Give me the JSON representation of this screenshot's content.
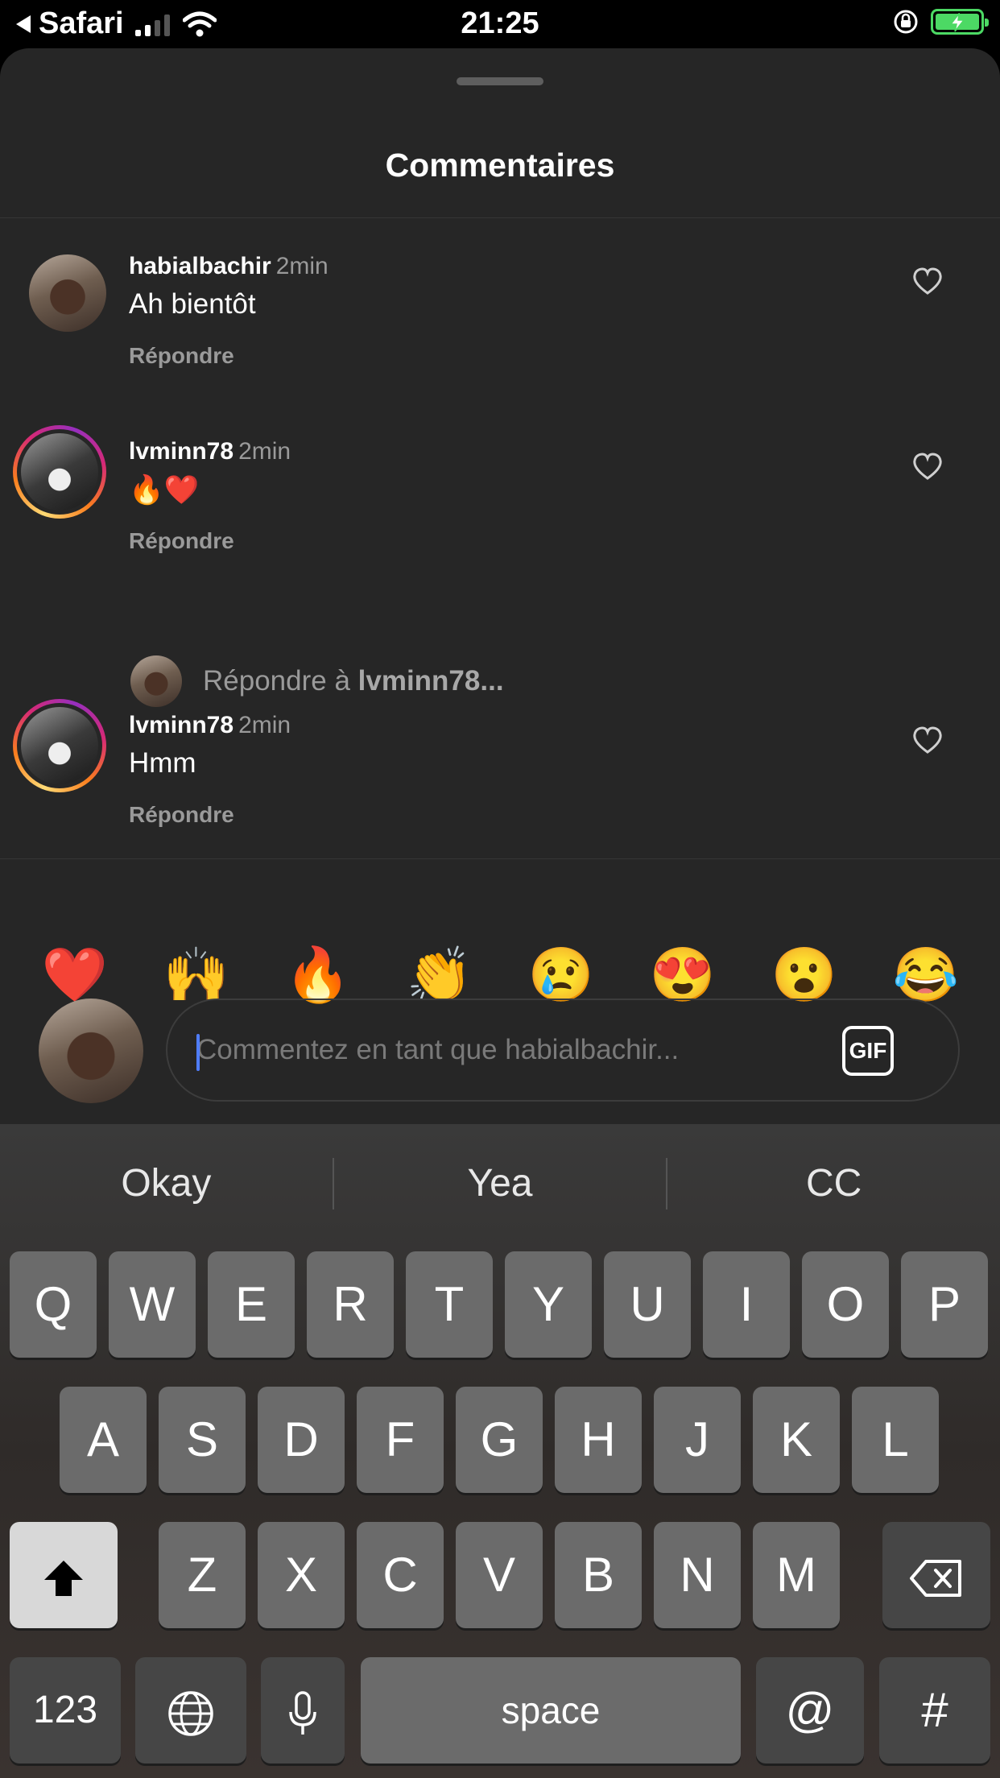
{
  "status": {
    "back_app": "Safari",
    "time": "21:25"
  },
  "sheet": {
    "title": "Commentaires"
  },
  "comments": [
    {
      "user": "habialbachir",
      "time": "2min",
      "text": "Ah bientôt",
      "reply": "Répondre"
    },
    {
      "user": "lvminn78",
      "time": "2min",
      "text": "🔥❤️",
      "reply": "Répondre"
    },
    {
      "user": "lvminn78",
      "time": "2min",
      "text": "Hmm",
      "reply": "Répondre"
    }
  ],
  "reply_hint": {
    "prefix": "Répondre à ",
    "user": "lvminn78..."
  },
  "emojis": [
    "❤️",
    "🙌",
    "🔥",
    "👏",
    "😢",
    "😍",
    "😮",
    "😂"
  ],
  "input": {
    "placeholder": "Commentez en tant que habialbachir...",
    "gif_label": "GIF"
  },
  "keyboard": {
    "predictions": [
      "Okay",
      "Yea",
      "CC"
    ],
    "row1": [
      "Q",
      "W",
      "E",
      "R",
      "T",
      "Y",
      "U",
      "I",
      "O",
      "P"
    ],
    "row2": [
      "A",
      "S",
      "D",
      "F",
      "G",
      "H",
      "J",
      "K",
      "L"
    ],
    "row3": [
      "Z",
      "X",
      "C",
      "V",
      "B",
      "N",
      "M"
    ],
    "numbers_label": "123",
    "space_label": "space",
    "at_label": "@",
    "hash_label": "#"
  },
  "icons": {
    "heart": "heart-outline-icon",
    "globe": "globe-icon",
    "mic": "microphone-icon",
    "shift": "shift-arrow-icon",
    "delete": "backspace-icon"
  }
}
